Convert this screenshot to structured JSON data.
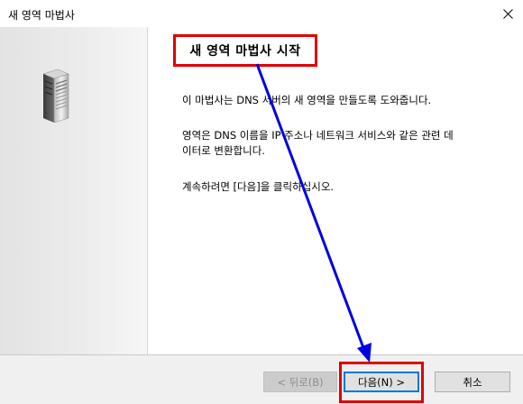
{
  "window": {
    "title": "새 영역 마법사",
    "close_icon": "close-icon"
  },
  "sidebar": {
    "illustration_icon": "server-tower-icon"
  },
  "content": {
    "heading": "새 영역 마법사 시작",
    "paragraph1": "이 마법사는 DNS 서버의 새 영역을 만들도록 도와줍니다.",
    "paragraph2_line1": "영역은 DNS 이름을 IP 주소나 네트워크 서비스와 같은 관련 데",
    "paragraph2_line2": "이터로 변환합니다.",
    "paragraph3": "계속하려면 [다음]을 클릭하십시오."
  },
  "footer": {
    "back_label": "< 뒤로(B)",
    "next_label": "다음(N) >",
    "cancel_label": "취소"
  },
  "annotation": {
    "highlight_color": "#e00000",
    "arrow_color": "#0000e0",
    "arrow_icon": "arrow-down-right-icon"
  }
}
